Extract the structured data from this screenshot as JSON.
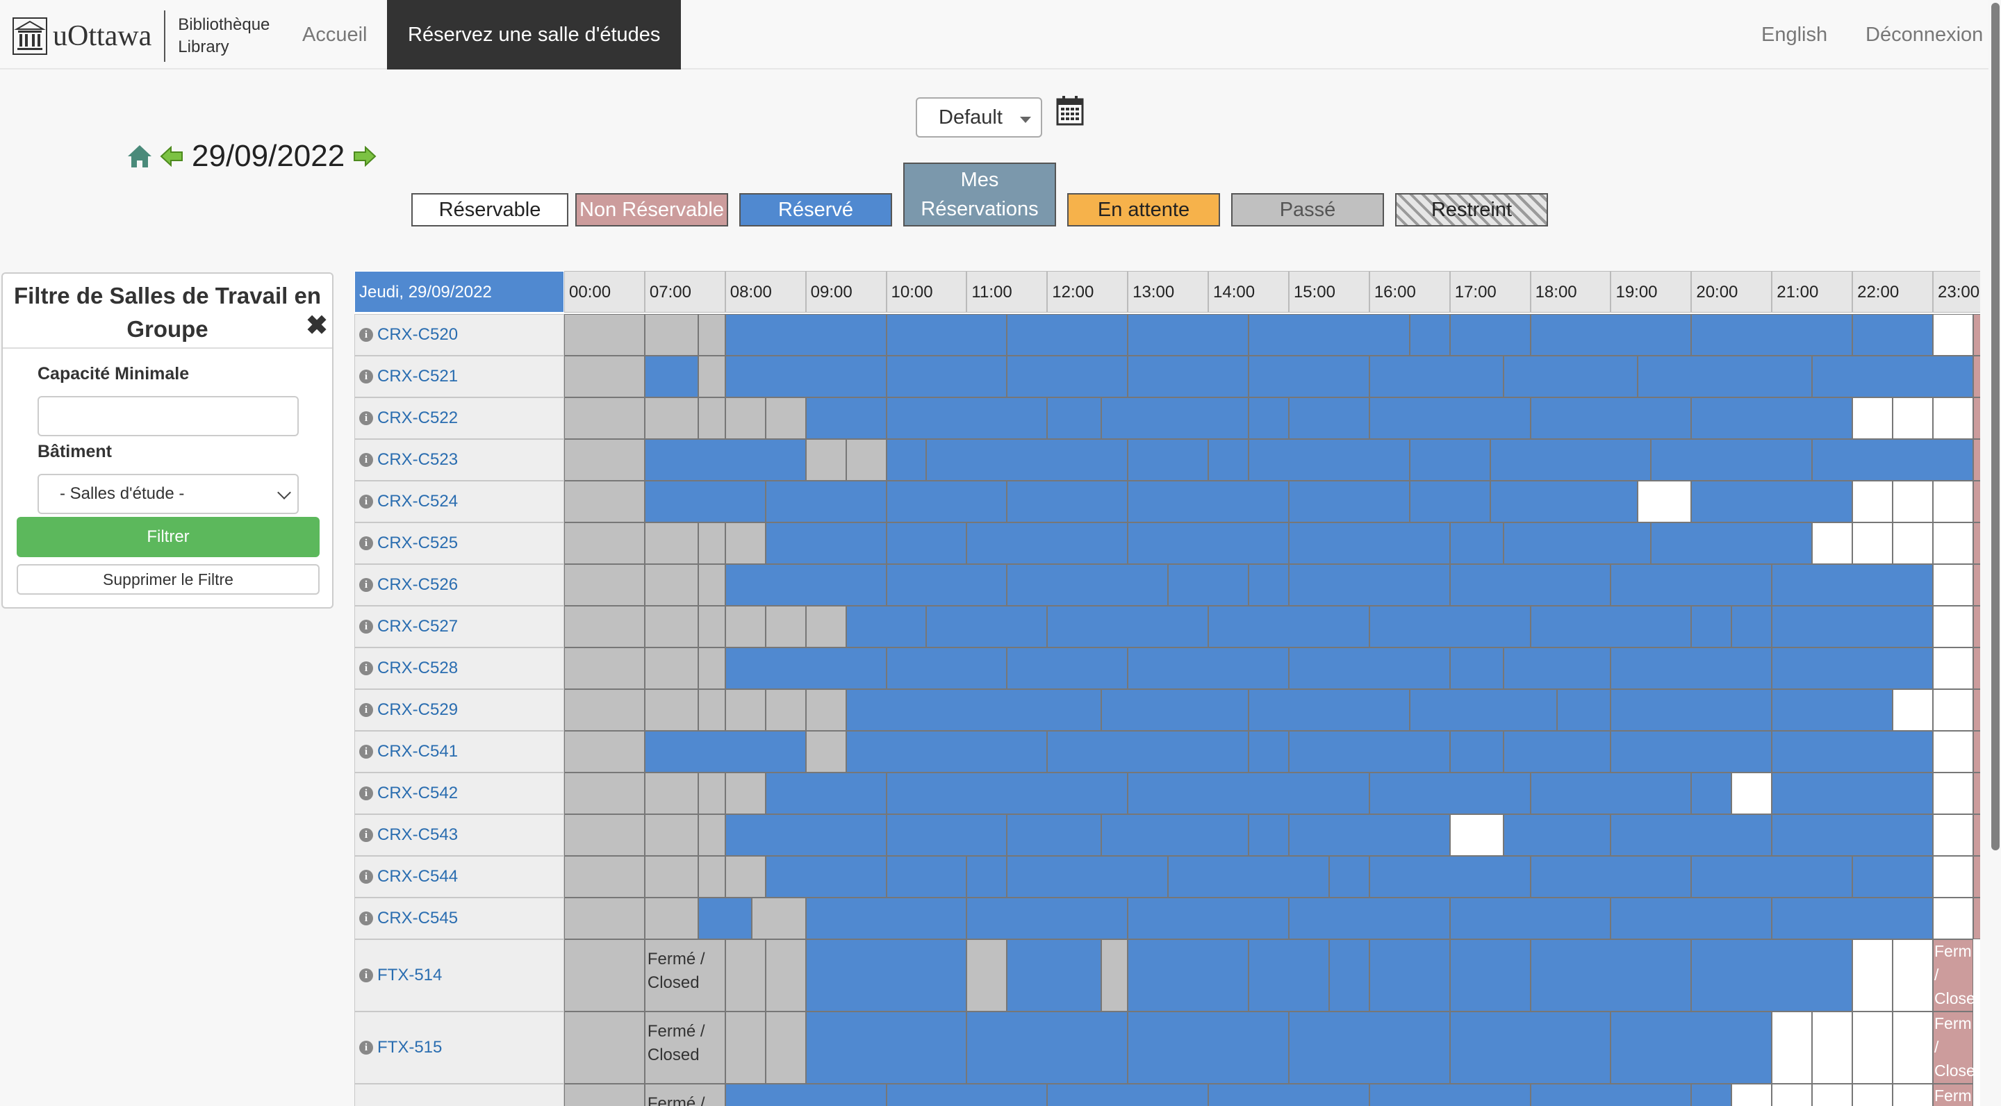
{
  "header": {
    "logo_text": "uOttawa",
    "library_line1": "Bibliothèque",
    "library_line2": "Library",
    "nav_home": "Accueil",
    "nav_active": "Réservez une salle d'études",
    "nav_english": "English",
    "nav_logout": "Déconnexion"
  },
  "controls": {
    "view_select": "Default",
    "date": "29/09/2022"
  },
  "legend": {
    "reservable": "Réservable",
    "non_reservable": "Non Réservable",
    "reserved": "Réservé",
    "my_res_line1": "Mes",
    "my_res_line2": "Réservations",
    "pending": "En attente",
    "past": "Passé",
    "restricted": "Restreint"
  },
  "colors": {
    "reserved": "#5089d0",
    "past": "#c0c0c0",
    "non_reservable": "#cc9c9c",
    "pending": "#f6b24b",
    "my_reservations": "#7b98ac",
    "filter_button": "#5cb85c"
  },
  "filter": {
    "title": "Filtre de Salles de Travail en Groupe",
    "min_capacity_label": "Capacité Minimale",
    "min_capacity_value": "",
    "building_label": "Bâtiment",
    "building_value": "- Salles d'étude -",
    "filter_button": "Filtrer",
    "clear_button": "Supprimer le Filtre"
  },
  "grid": {
    "day_header": "Jeudi, 29/09/2022",
    "hours": [
      "00:00",
      "07:00",
      "08:00",
      "09:00",
      "10:00",
      "11:00",
      "12:00",
      "13:00",
      "14:00",
      "15:00",
      "16:00",
      "17:00",
      "18:00",
      "19:00",
      "20:00",
      "21:00",
      "22:00",
      "23:00"
    ],
    "rooms": [
      "CRX-C520",
      "CRX-C521",
      "CRX-C522",
      "CRX-C523",
      "CRX-C524",
      "CRX-C525",
      "CRX-C526",
      "CRX-C527",
      "CRX-C528",
      "CRX-C529",
      "CRX-C541",
      "CRX-C542",
      "CRX-C543",
      "CRX-C544",
      "CRX-C545",
      "FTX-514",
      "FTX-515"
    ],
    "closed_text_line1": "Fermé /",
    "closed_text_line2": "Closed",
    "closed_short_1": "Ferm",
    "closed_short_2": "/",
    "closed_short_3": "Close"
  }
}
